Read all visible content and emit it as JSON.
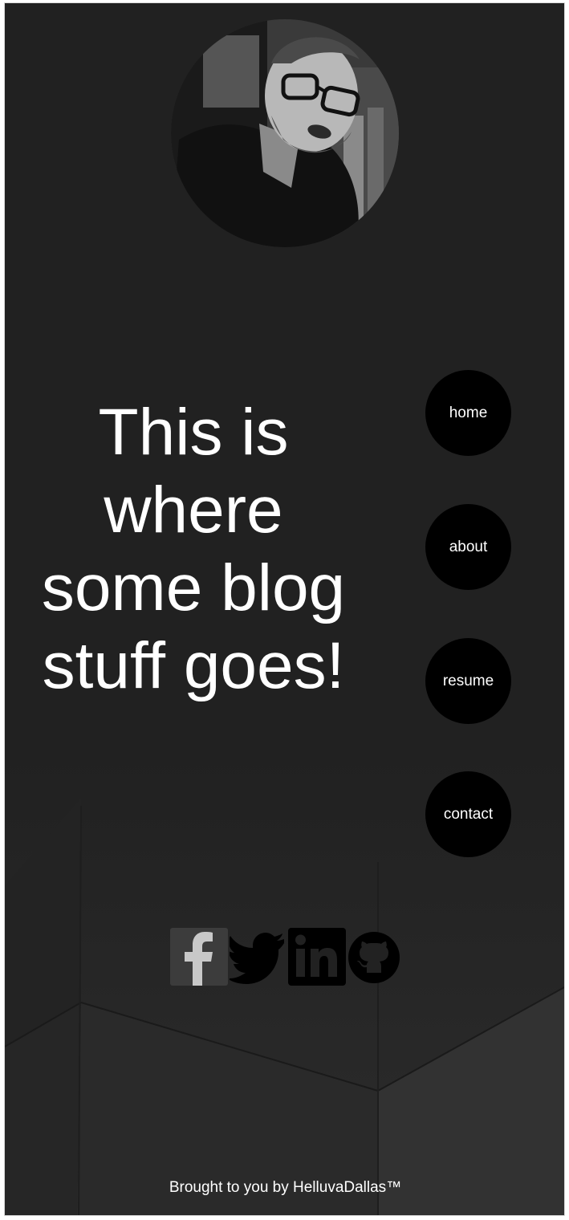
{
  "profile": {
    "photo_alt": "profile photo"
  },
  "headline": {
    "text": "This is where some blog stuff goes!"
  },
  "nav": {
    "items": [
      {
        "label": "home"
      },
      {
        "label": "about"
      },
      {
        "label": "resume"
      },
      {
        "label": "contact"
      }
    ]
  },
  "social": {
    "items": [
      {
        "name": "facebook",
        "icon": "facebook-icon"
      },
      {
        "name": "twitter",
        "icon": "twitter-icon"
      },
      {
        "name": "linkedin",
        "icon": "linkedin-icon"
      },
      {
        "name": "github",
        "icon": "github-icon"
      }
    ]
  },
  "footer": {
    "text": "Brought to you by HelluvaDallas™"
  },
  "colors": {
    "background": "#212121",
    "nav_circle": "#000000",
    "text": "#ffffff"
  }
}
